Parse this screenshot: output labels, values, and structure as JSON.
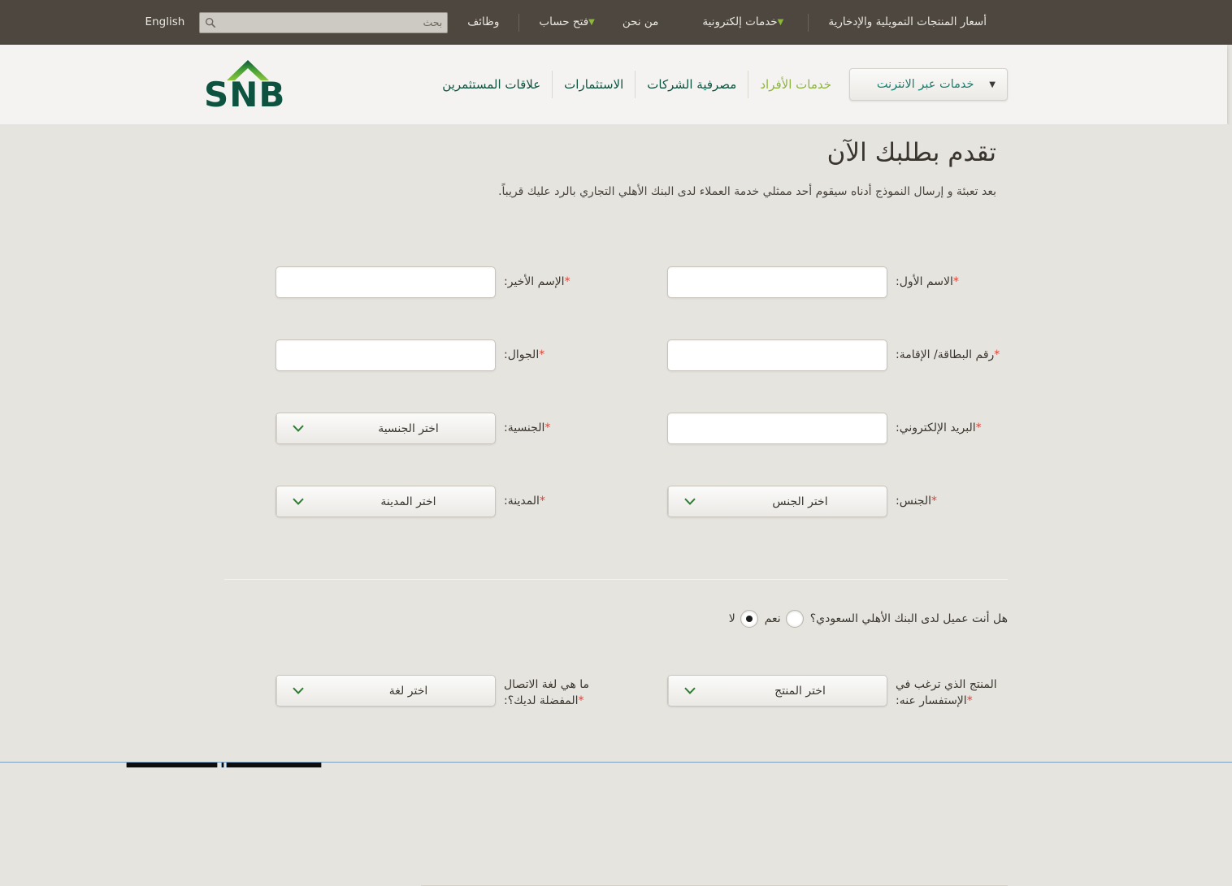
{
  "topbar": {
    "links": [
      {
        "label": "أسعار المنتجات التمويلية والإدخارية",
        "caret": false,
        "green": false
      },
      {
        "label": "خدمات إلكترونية",
        "caret": true,
        "green": false
      },
      {
        "label": "من نحن",
        "caret": false,
        "green": false
      },
      {
        "label": "فتح حساب",
        "caret": true,
        "green": false
      },
      {
        "label": "وظائف",
        "caret": false,
        "green": false
      }
    ],
    "search": {
      "placeholder": "بحث",
      "value": "",
      "icon": "search-icon"
    },
    "language_toggle": "English",
    "background_color": "#4e4740",
    "caret_color": "#8db63c"
  },
  "header": {
    "logo": {
      "text": "SNB",
      "color": "#0d5340",
      "arch_color": "#8dc63f"
    },
    "online_button": {
      "label": "خدمات عبر الانترنت",
      "caret": "▼",
      "color": "#1a8071"
    },
    "nav_items": [
      {
        "label": "خدمات الأفراد",
        "active": true
      },
      {
        "label": "مصرفية الشركات",
        "active": false
      },
      {
        "label": "الاستثمارات",
        "active": false
      },
      {
        "label": "علاقات المستثمرين",
        "active": false
      }
    ],
    "background_color": "#f4f3f1"
  },
  "main": {
    "title": "تقدم بطلبك الآن",
    "subtitle": "بعد تعبئة و إرسال النموذج أدناه سيقوم أحد ممثلي خدمة العملاء لدى البنك الأهلي التجاري بالرد عليك قريباً.",
    "required_marker": "*",
    "required_color": "#d8453a"
  },
  "form": {
    "rows": [
      {
        "right": {
          "label": "الاسم الأول:",
          "required": true,
          "type": "text",
          "value": ""
        },
        "left": {
          "label": "الإسم الأخير:",
          "required": true,
          "type": "text",
          "value": ""
        }
      },
      {
        "right": {
          "label": "رقم البطاقة/ الإقامة:",
          "required": true,
          "type": "text",
          "value": ""
        },
        "left": {
          "label": "الجوال:",
          "required": true,
          "type": "text",
          "value": ""
        }
      },
      {
        "right": {
          "label": "البريد الإلكتروني:",
          "required": true,
          "type": "text",
          "value": ""
        },
        "left": {
          "label": "الجنسية:",
          "required": true,
          "type": "select",
          "value": "اختر الجنسية"
        }
      },
      {
        "right": {
          "label": "الجنس:",
          "required": true,
          "type": "select",
          "value": "اختر الجنس"
        },
        "left": {
          "label": "المدينة:",
          "required": true,
          "type": "select",
          "value": "اختر المدينة"
        }
      }
    ],
    "question": {
      "text": "هل أنت عميل لدى البنك الأهلي السعودي؟",
      "options": [
        {
          "label": "نعم",
          "checked": false
        },
        {
          "label": "لا",
          "checked": true
        }
      ]
    },
    "bottom_row": {
      "right": {
        "label_line1": "المنتج الذي ترغب في",
        "label_line2": "الإستفسار عنه:",
        "required": true,
        "type": "select",
        "value": "اختر المنتج"
      },
      "left": {
        "label_line1": "ما هي لغة الاتصال",
        "label_line2": "المفضلة لديك؟:",
        "required": true,
        "type": "select",
        "value": "اختر لغة"
      }
    }
  }
}
